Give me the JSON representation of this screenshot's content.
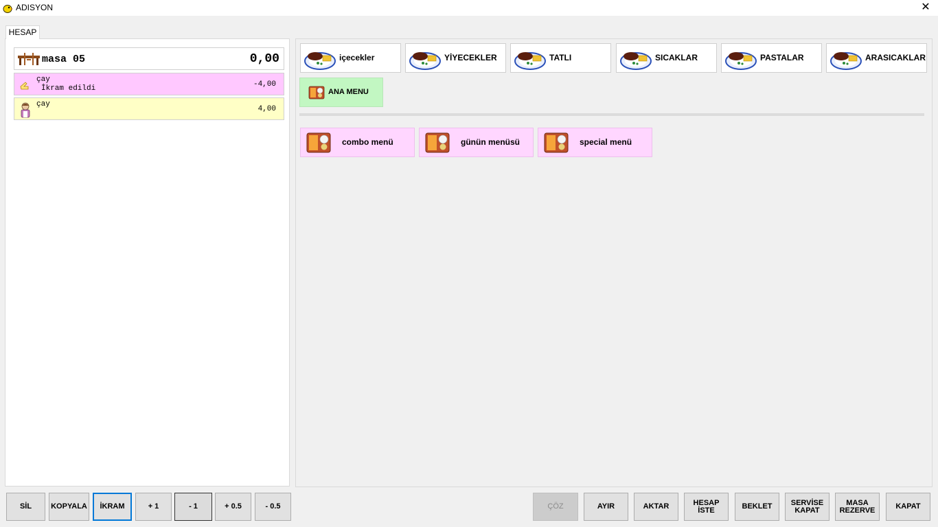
{
  "window": {
    "title": "ADISYON",
    "app_icon": "chick-icon",
    "close_icon": "close-icon"
  },
  "tab": {
    "label": "HESAP"
  },
  "table": {
    "name": "masa 05",
    "total": "0,00",
    "icon": "dining-table-icon"
  },
  "order_items": [
    {
      "name": "çay",
      "note": "İkram edildi",
      "price": "-4,00",
      "icon": "gift-hand-icon",
      "color": "#ffc8ff"
    },
    {
      "name": "çay",
      "note": "",
      "price": "4,00",
      "icon": "waiter-icon",
      "color": "#ffffc6"
    }
  ],
  "categories": [
    {
      "label": "içecekler",
      "icon": "food-plate-icon"
    },
    {
      "label": "YİYECEKLER",
      "icon": "food-plate-icon"
    },
    {
      "label": "TATLI",
      "icon": "food-plate-icon"
    },
    {
      "label": "SICAKLAR",
      "icon": "food-plate-icon"
    },
    {
      "label": "PASTALAR",
      "icon": "food-plate-icon"
    },
    {
      "label": "ARASICAKLAR",
      "icon": "food-plate-icon"
    }
  ],
  "ana_menu": {
    "label": "ANA MENU",
    "icon": "food-tray-icon",
    "color": "#c2f7c2"
  },
  "menus": [
    {
      "label": "combo menü",
      "icon": "food-tray-icon"
    },
    {
      "label": "günün menüsü",
      "icon": "food-tray-icon"
    },
    {
      "label": "special menü",
      "icon": "food-tray-icon"
    }
  ],
  "left_actions": {
    "sil": "SİL",
    "kopyala": "KOPYALA",
    "ikram": "İKRAM",
    "plus1": "+ 1",
    "minus1": "- 1",
    "plus05": "+ 0.5",
    "minus05": "- 0.5"
  },
  "right_actions": {
    "coz": "ÇÖZ",
    "ayir": "AYIR",
    "aktar": "AKTAR",
    "hesap_iste": [
      "HESAP",
      "İSTE"
    ],
    "beklet": "BEKLET",
    "servise_kapat": [
      "SERVİSE",
      "KAPAT"
    ],
    "masa_rezerve": [
      "MASA",
      "REZERVE"
    ],
    "kapat": "KAPAT"
  },
  "colors": {
    "accent": "#0078d7",
    "menu_pink": "#ffd6ff",
    "window_bg": "#f0f0f0"
  }
}
